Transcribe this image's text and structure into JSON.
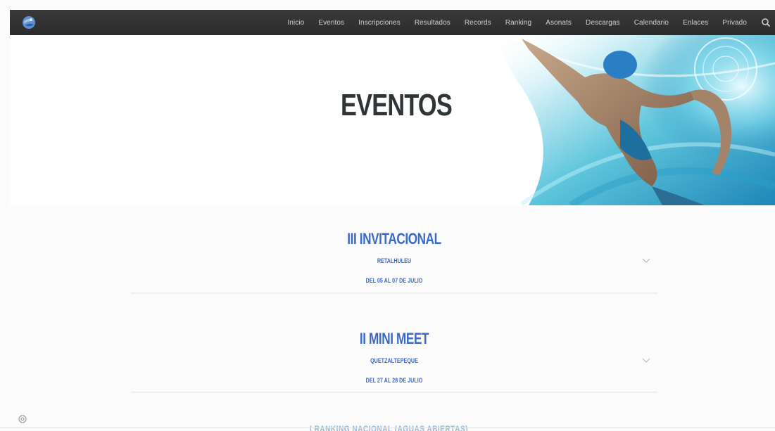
{
  "nav": {
    "items": [
      {
        "label": "Inicio"
      },
      {
        "label": "Eventos"
      },
      {
        "label": "Inscripciones"
      },
      {
        "label": "Resultados"
      },
      {
        "label": "Records"
      },
      {
        "label": "Ranking"
      },
      {
        "label": "Asonats"
      },
      {
        "label": "Descargas"
      },
      {
        "label": "Calendario"
      },
      {
        "label": "Enlaces"
      },
      {
        "label": "Privado"
      }
    ],
    "search_icon": "search-icon",
    "logo_icon": "federation-logo"
  },
  "hero": {
    "title": "EVENTOS"
  },
  "events": [
    {
      "title": "III INVITACIONAL",
      "place": "RETALHULEU",
      "date": "DEL 05 AL 07 DE JULIO"
    },
    {
      "title": "II MINI MEET",
      "place": "QUETZALTEPEQUE",
      "date": "DEL 27 AL 28 DE JULIO"
    }
  ],
  "footer": {
    "heading": "I RANKING NACIONAL (AGUAS ABIERTAS)"
  },
  "colors": {
    "accent": "#3a6bc4",
    "topbar": "#2f2f2f",
    "hero_title": "#2f3436"
  }
}
